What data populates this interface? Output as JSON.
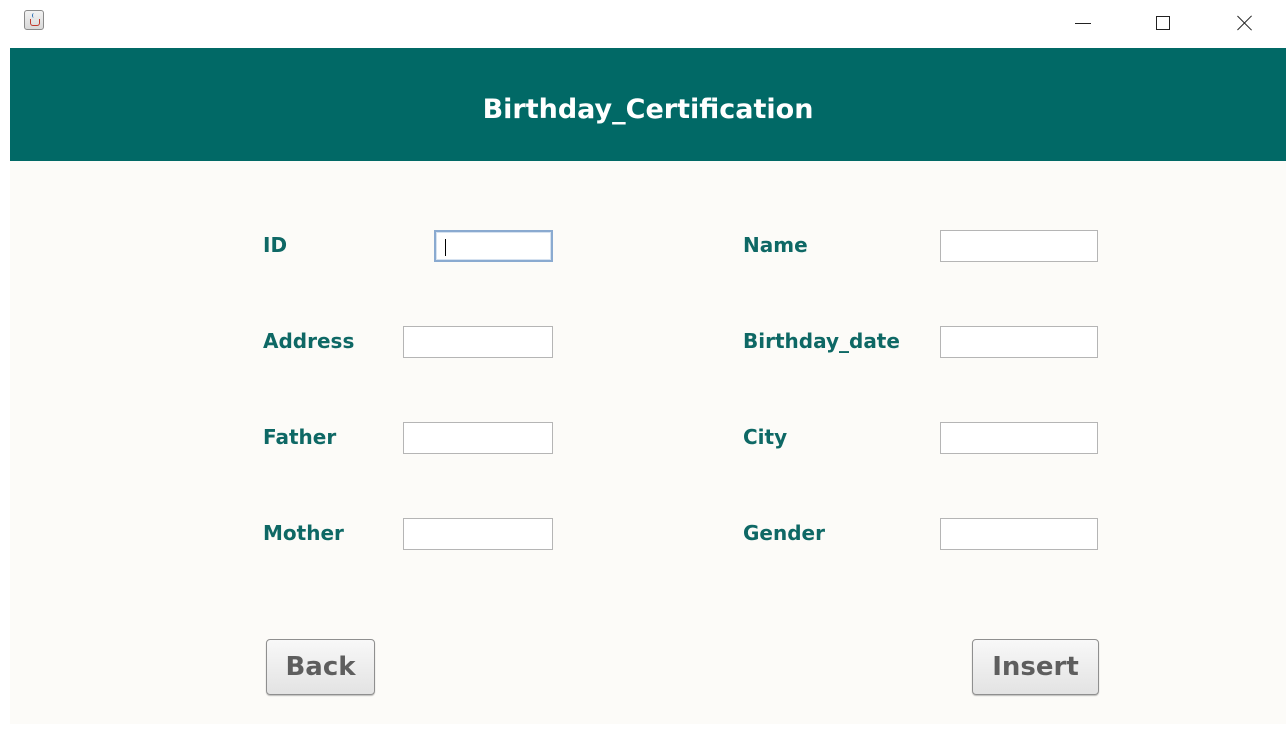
{
  "window": {
    "icon": "java-cup-icon",
    "controls": [
      "minimize",
      "maximize",
      "close"
    ]
  },
  "header": {
    "title": "Birthday_Certification",
    "background": "#016966",
    "text_color": "#ffffff"
  },
  "form": {
    "label_color": "#0e6865",
    "id": {
      "label": "ID",
      "value": ""
    },
    "address": {
      "label": "Address",
      "value": ""
    },
    "father": {
      "label": "Father",
      "value": ""
    },
    "mother": {
      "label": "Mother",
      "value": ""
    },
    "name": {
      "label": "Name",
      "value": ""
    },
    "birthday_date": {
      "label": "Birthday_date",
      "value": ""
    },
    "city": {
      "label": "City",
      "value": ""
    },
    "gender": {
      "label": "Gender",
      "value": ""
    }
  },
  "buttons": {
    "back_label": "Back",
    "insert_label": "Insert"
  }
}
